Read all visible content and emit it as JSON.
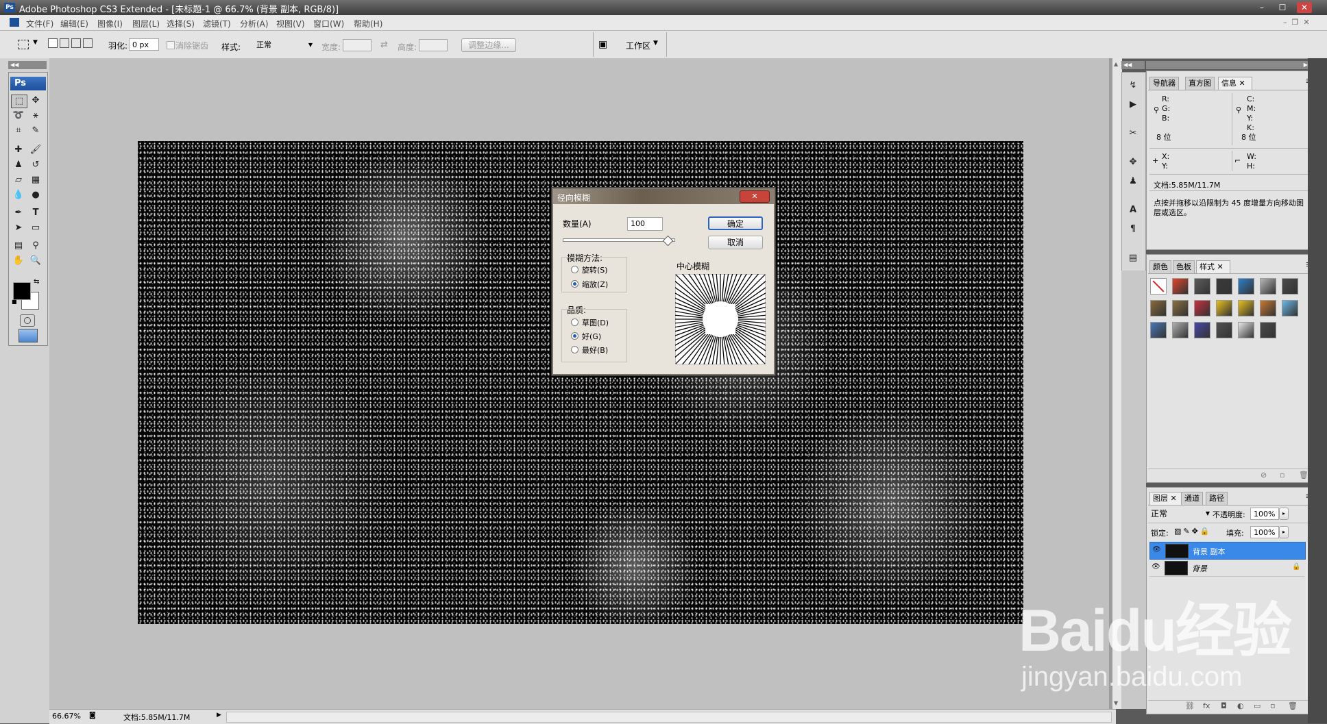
{
  "window": {
    "title": "Adobe Photoshop CS3 Extended - [未标题-1 @ 66.7% (背景 副本, RGB/8)]",
    "app_icon": "Ps",
    "controls": [
      "–",
      "☐",
      "✕"
    ]
  },
  "menubar": {
    "items": [
      "文件(F)",
      "编辑(E)",
      "图像(I)",
      "图层(L)",
      "选择(S)",
      "滤镜(T)",
      "分析(A)",
      "视图(V)",
      "窗口(W)",
      "帮助(H)"
    ]
  },
  "options": {
    "feather_label": "羽化:",
    "feather_value": "0 px",
    "antialias_label": "消除锯齿",
    "style_label": "样式:",
    "style_value": "正常",
    "width_label": "宽度:",
    "height_label": "高度:",
    "refine_edge": "调整边缘...",
    "workspace": "工作区"
  },
  "toolbox": {
    "logo": "Ps",
    "foreground_color": "#000000",
    "background_color": "#ffffff"
  },
  "dialog": {
    "title": "径向模糊",
    "amount_label": "数量(A)",
    "amount_value": "100",
    "ok": "确定",
    "cancel": "取消",
    "method_label": "模糊方法:",
    "method_spin": "旋转(S)",
    "method_zoom": "缩放(Z)",
    "method_selected": "zoom",
    "quality_label": "品质:",
    "quality_draft": "草图(D)",
    "quality_good": "好(G)",
    "quality_best": "最好(B)",
    "quality_selected": "good",
    "center_label": "中心模糊"
  },
  "info_panel": {
    "tabs": [
      "导航器",
      "直方图",
      "信息"
    ],
    "active_tab": "信息",
    "rgb_labels": [
      "R:",
      "G:",
      "B:"
    ],
    "cmyk_labels": [
      "C:",
      "M:",
      "Y:",
      "K:"
    ],
    "bit_left": "8 位",
    "bit_right": "8 位",
    "xy_labels": [
      "X:",
      "Y:"
    ],
    "wh_labels": [
      "W:",
      "H:"
    ],
    "doc": "文档:5.85M/11.7M",
    "hint": "点按并拖移以沿限制为 45 度增量方向移动图层或选区。"
  },
  "styles_panel": {
    "tabs": [
      "颜色",
      "色板",
      "样式"
    ],
    "active_tab": "样式",
    "swatches": [
      "#ffffff",
      "#e0452a",
      "#5c5c5c",
      "#3a3a3a",
      "#2e7fc9",
      "#b5b5b5",
      "#4a4a4a",
      "#8a6a3a",
      "#8a7040",
      "#c83040",
      "#e8c020",
      "#e8c020",
      "#c87830",
      "#6ab8e8",
      "#4a78b8",
      "#b0b0b0",
      "#4848a8",
      "#505050",
      "#e8e8e8",
      "#4a4a4a"
    ]
  },
  "layers_panel": {
    "tabs": [
      "图层",
      "通道",
      "路径"
    ],
    "active_tab": "图层",
    "blend_mode": "正常",
    "opacity_label": "不透明度:",
    "opacity_value": "100%",
    "lock_label": "锁定:",
    "fill_label": "填充:",
    "fill_value": "100%",
    "layers": [
      {
        "name": "背景 副本",
        "selected": true
      },
      {
        "name": "背景",
        "selected": false
      }
    ]
  },
  "status": {
    "zoom": "66.67%",
    "doc": "文档:5.85M/11.7M"
  },
  "watermark": {
    "brand": "Baidu经验",
    "url": "jingyan.baidu.com"
  }
}
